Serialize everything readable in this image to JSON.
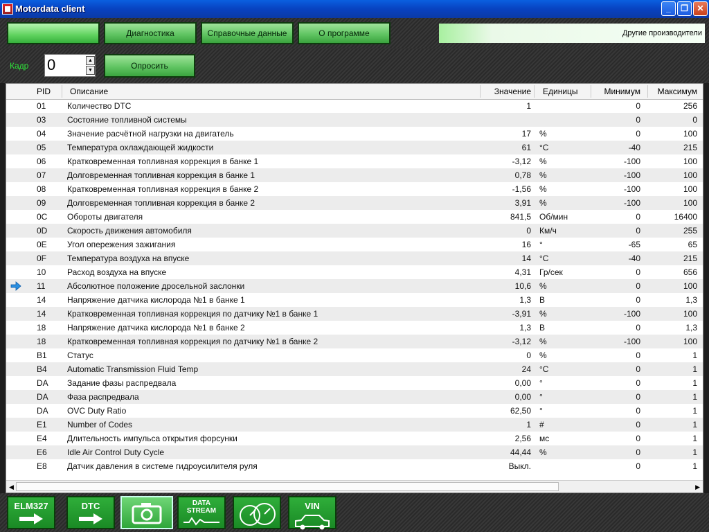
{
  "window": {
    "title": "Motordata client"
  },
  "menu": {
    "items": [
      "",
      "Диагностика",
      "Справочные данные",
      "О программе"
    ],
    "other_makers": "Другие производители"
  },
  "toolbar": {
    "frame_label": "Кадр",
    "frame_value": "0",
    "poll_label": "Опросить"
  },
  "table": {
    "headers": {
      "pid": "PID",
      "desc": "Описание",
      "value": "Значение",
      "units": "Единицы",
      "min": "Минимум",
      "max": "Максимум"
    },
    "rows": [
      {
        "pid": "01",
        "desc": "Количество DTC",
        "value": "1",
        "unit": "",
        "min": "0",
        "max": "256"
      },
      {
        "pid": "03",
        "desc": "Состояние топливной системы",
        "value": "",
        "unit": "",
        "min": "0",
        "max": "0"
      },
      {
        "pid": "04",
        "desc": "Значение расчётной нагрузки на двигатель",
        "value": "17",
        "unit": "%",
        "min": "0",
        "max": "100"
      },
      {
        "pid": "05",
        "desc": "Температура охлаждающей жидкости",
        "value": "61",
        "unit": "°C",
        "min": "-40",
        "max": "215"
      },
      {
        "pid": "06",
        "desc": "Кратковременная топливная коррекция в банке 1",
        "value": "-3,12",
        "unit": "%",
        "min": "-100",
        "max": "100"
      },
      {
        "pid": "07",
        "desc": "Долговременная топливная коррекция в банке 1",
        "value": "0,78",
        "unit": "%",
        "min": "-100",
        "max": "100"
      },
      {
        "pid": "08",
        "desc": "Кратковременная топливная коррекция в банке 2",
        "value": "-1,56",
        "unit": "%",
        "min": "-100",
        "max": "100"
      },
      {
        "pid": "09",
        "desc": "Долговременная топливная коррекция в банке 2",
        "value": "3,91",
        "unit": "%",
        "min": "-100",
        "max": "100"
      },
      {
        "pid": "0C",
        "desc": "Обороты двигателя",
        "value": "841,5",
        "unit": "Об/мин",
        "min": "0",
        "max": "16400"
      },
      {
        "pid": "0D",
        "desc": "Скорость движения автомобиля",
        "value": "0",
        "unit": "Км/ч",
        "min": "0",
        "max": "255"
      },
      {
        "pid": "0E",
        "desc": "Угол опережения зажигания",
        "value": "16",
        "unit": "°",
        "min": "-65",
        "max": "65"
      },
      {
        "pid": "0F",
        "desc": "Температура воздуха на впуске",
        "value": "14",
        "unit": "°C",
        "min": "-40",
        "max": "215"
      },
      {
        "pid": "10",
        "desc": "Расход воздуха на впуске",
        "value": "4,31",
        "unit": "Гр/сек",
        "min": "0",
        "max": "656"
      },
      {
        "pid": "11",
        "desc": "Абсолютное положение дросельной заслонки",
        "value": "10,6",
        "unit": "%",
        "min": "0",
        "max": "100",
        "current": true
      },
      {
        "pid": "14",
        "desc": "Напряжение датчика кислорода №1 в банке 1",
        "value": "1,3",
        "unit": "В",
        "min": "0",
        "max": "1,3"
      },
      {
        "pid": "14",
        "desc": "Кратковременная топливная коррекция по датчику №1 в банке 1",
        "value": "-3,91",
        "unit": "%",
        "min": "-100",
        "max": "100"
      },
      {
        "pid": "18",
        "desc": "Напряжение датчика кислорода №1 в банке 2",
        "value": "1,3",
        "unit": "В",
        "min": "0",
        "max": "1,3"
      },
      {
        "pid": "18",
        "desc": "Кратковременная топливная коррекция по датчику №1 в банке 2",
        "value": "-3,12",
        "unit": "%",
        "min": "-100",
        "max": "100"
      },
      {
        "pid": "B1",
        "desc": "Статус",
        "value": "0",
        "unit": "%",
        "min": "0",
        "max": "1"
      },
      {
        "pid": "B4",
        "desc": "Automatic Transmission Fluid Temp",
        "value": "24",
        "unit": "°C",
        "min": "0",
        "max": "1"
      },
      {
        "pid": "DA",
        "desc": "Задание фазы распредвала",
        "value": "0,00",
        "unit": "°",
        "min": "0",
        "max": "1"
      },
      {
        "pid": "DA",
        "desc": "Фаза распредвала",
        "value": "0,00",
        "unit": "°",
        "min": "0",
        "max": "1"
      },
      {
        "pid": "DA",
        "desc": "OVC Duty Ratio",
        "value": "62,50",
        "unit": "°",
        "min": "0",
        "max": "1"
      },
      {
        "pid": "E1",
        "desc": "Number of Codes",
        "value": "1",
        "unit": "#",
        "min": "0",
        "max": "1"
      },
      {
        "pid": "E4",
        "desc": "Длительность импульса открытия форсунки",
        "value": "2,56",
        "unit": "мс",
        "min": "0",
        "max": "1"
      },
      {
        "pid": "E6",
        "desc": "Idle Air Control Duty Cycle",
        "value": "44,44",
        "unit": "%",
        "min": "0",
        "max": "1"
      },
      {
        "pid": "E8",
        "desc": "Датчик давления в системе гидроусилителя руля",
        "value": "Выкл.",
        "unit": "",
        "min": "0",
        "max": "1"
      }
    ]
  },
  "bottom_tools": [
    {
      "label": "ELM327",
      "icon": "arrow-right-icon"
    },
    {
      "label": "DTC",
      "icon": "arrow-right-icon"
    },
    {
      "label": "",
      "icon": "camera-icon",
      "active": true
    },
    {
      "label": "DATA STREAM",
      "icon": "waveform-icon"
    },
    {
      "label": "",
      "icon": "gauges-icon"
    },
    {
      "label": "VIN",
      "icon": "car-icon"
    }
  ]
}
